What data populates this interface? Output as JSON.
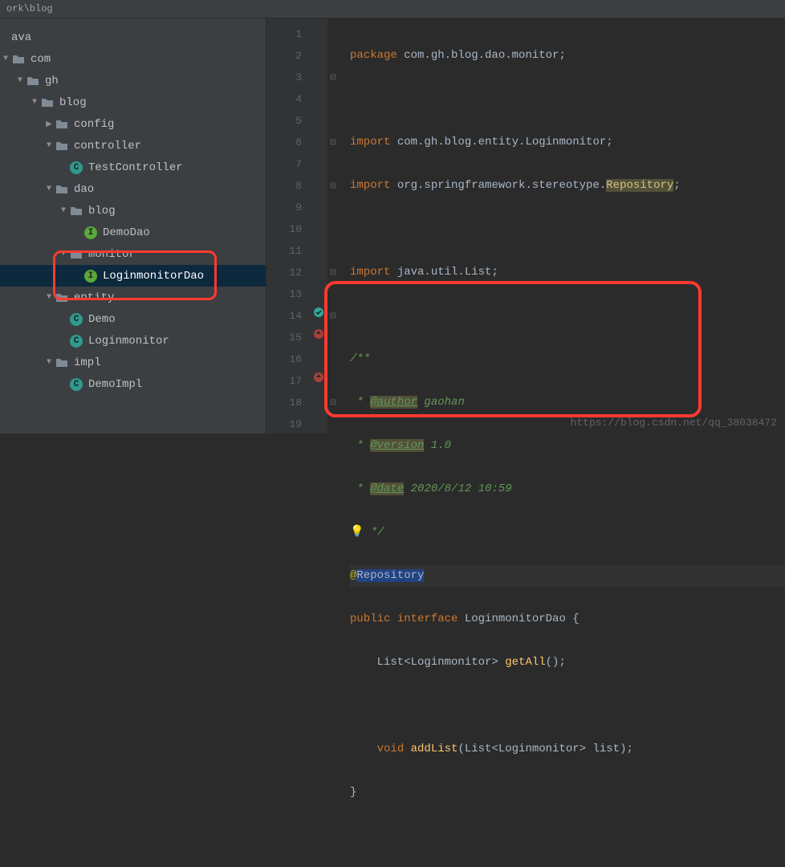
{
  "breadcrumb": "ork\\blog",
  "tree": {
    "ava": "ava",
    "com": "com",
    "gh": "gh",
    "blog": "blog",
    "config": "config",
    "controller": "controller",
    "testcontroller": "TestController",
    "dao": "dao",
    "dao_blog": "blog",
    "demodao": "DemoDao",
    "monitor": "monitor",
    "loginmonitordao": "LoginmonitorDao",
    "entity": "entity",
    "demo": "Demo",
    "loginmonitor": "Loginmonitor",
    "impl": "impl",
    "demoimpl": "DemoImpl"
  },
  "gutter": [
    "1",
    "2",
    "3",
    "4",
    "5",
    "6",
    "7",
    "8",
    "9",
    "10",
    "11",
    "12",
    "13",
    "14",
    "15",
    "16",
    "17",
    "18",
    "19"
  ],
  "code": {
    "l1_kw": "package",
    "l1_rest": " com.gh.blog.dao.monitor;",
    "l3_kw": "import",
    "l3_rest": " com.gh.blog.entity.Loginmonitor;",
    "l4_kw": "import",
    "l4_rest_a": " org.springframework.stereotype.",
    "l4_hl": "Repository",
    "l4_end": ";",
    "l6_kw": "import",
    "l6_rest": " java.util.List;",
    "l8": "/**",
    "l9_a": " * ",
    "l9_tag": "@author",
    "l9_b": " gaohan",
    "l10_a": " * ",
    "l10_tag": "@version",
    "l10_b": " 1.0",
    "l11_a": " * ",
    "l11_tag": "@date",
    "l11_b": " 2020/8/12 10:59",
    "l12": " */",
    "l13_ann": "@",
    "l13_rep": "Repository",
    "l14_pub": "public",
    "l14_int": " interface ",
    "l14_name": "LoginmonitorDao",
    "l14_brace": " {",
    "l15_a": "    List<Loginmonitor> ",
    "l15_m": "getAll",
    "l15_b": "();",
    "l17_a": "    ",
    "l17_kw": "void",
    "l17_sp": " ",
    "l17_m": "addList",
    "l17_b": "(List<Loginmonitor> list);",
    "l18": "}"
  },
  "watermark": "https://blog.csdn.net/qq_38038472"
}
